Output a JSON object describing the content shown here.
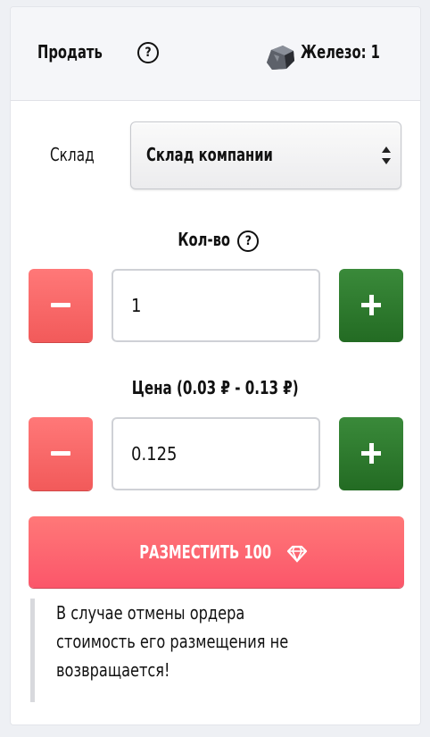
{
  "header": {
    "title": "Продать",
    "resource_icon": "iron-ore-icon",
    "resource_label": "Железо: 1"
  },
  "warehouse": {
    "label": "Склад",
    "selected": "Склад компании"
  },
  "quantity": {
    "label": "Кол-во",
    "value": "1"
  },
  "price": {
    "label": "Цена (0.03 ₽ - 0.13 ₽)",
    "value": "0.125"
  },
  "place_button": {
    "label": "РАЗМЕСТИТЬ 100",
    "icon": "diamond-icon"
  },
  "notice": {
    "line1": "В случае отмены ордера",
    "line2": "стоимость его размещения не",
    "line3": "возвращается!"
  },
  "colors": {
    "minus_button": "#f96363",
    "plus_button": "#2e7d2e",
    "place_button": "#fb5f6c"
  }
}
